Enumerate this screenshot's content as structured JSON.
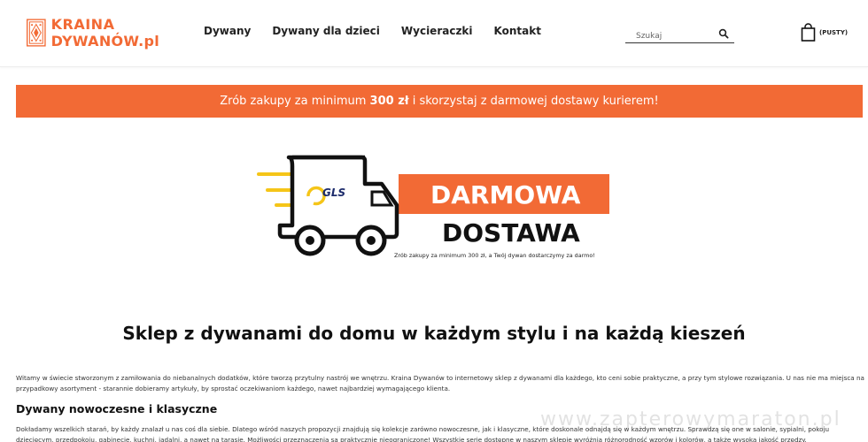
{
  "logo": {
    "line1": "KRAINA",
    "line2": "DYWANÓW.pl"
  },
  "nav": {
    "items": [
      {
        "label": "Dywany"
      },
      {
        "label": "Dywany dla dzieci"
      },
      {
        "label": "Wycieraczki"
      },
      {
        "label": "Kontakt"
      }
    ]
  },
  "search": {
    "placeholder": "Szukaj"
  },
  "cart": {
    "label": "(PUSTY)"
  },
  "promo": {
    "before": "Zrób zakupy za minimum ",
    "amount": "300 zł",
    "after": " i skorzystaj z darmowej dostawy kurierem!"
  },
  "banner": {
    "brand": "GLS",
    "line1": "DARMOWA",
    "line2": "DOSTAWA",
    "caption": "Zrób zakupy za minimum 300 zł, a Twój dywan dostarczymy za darmo!"
  },
  "main": {
    "heading": "Sklep z dywanami do domu w każdym stylu i na każdą kieszeń",
    "intro": "Witamy w świecie stworzonym z zamiłowania do niebanalnych dodatków, które tworzą przytulny nastrój we wnętrzu. Kraina Dywanów to internetowy sklep z dywanami dla każdego, kto ceni sobie praktyczne, a przy tym stylowe rozwiązania. U nas nie ma miejsca na przypadkowy asortyment - starannie dobieramy artykuły, by sprostać oczekiwaniom każdego, nawet najbardziej wymagającego klienta.",
    "subheading": "Dywany nowoczesne i klasyczne",
    "para2": "Dokładamy wszelkich starań, by każdy znalazł u nas coś dla siebie. Dlatego wśród naszych propozycji znajdują się kolekcje zarówno nowoczesne, jak i klasyczne, które doskonale odnajdą się w każdym wnętrzu. Sprawdzą się one w salonie, sypialni, pokoju dziecięcym, przedpokoju, gabinecie, kuchni, jadalni, a nawet na tarasie. Możliwości przeznaczenia są praktycznie nieograniczone! Wszystkie serie dostępne w naszym sklepie wyróżnia różnorodność wzorów i kolorów, a także wysoka jakość przędzy."
  },
  "watermark": "www.zapterowymaraton.pl",
  "colors": {
    "accent": "#f26a35",
    "yellow": "#f5c518",
    "text": "#222222"
  },
  "icons": [
    "logo-mark-icon",
    "search-icon",
    "shopping-bag-icon",
    "truck-icon"
  ]
}
